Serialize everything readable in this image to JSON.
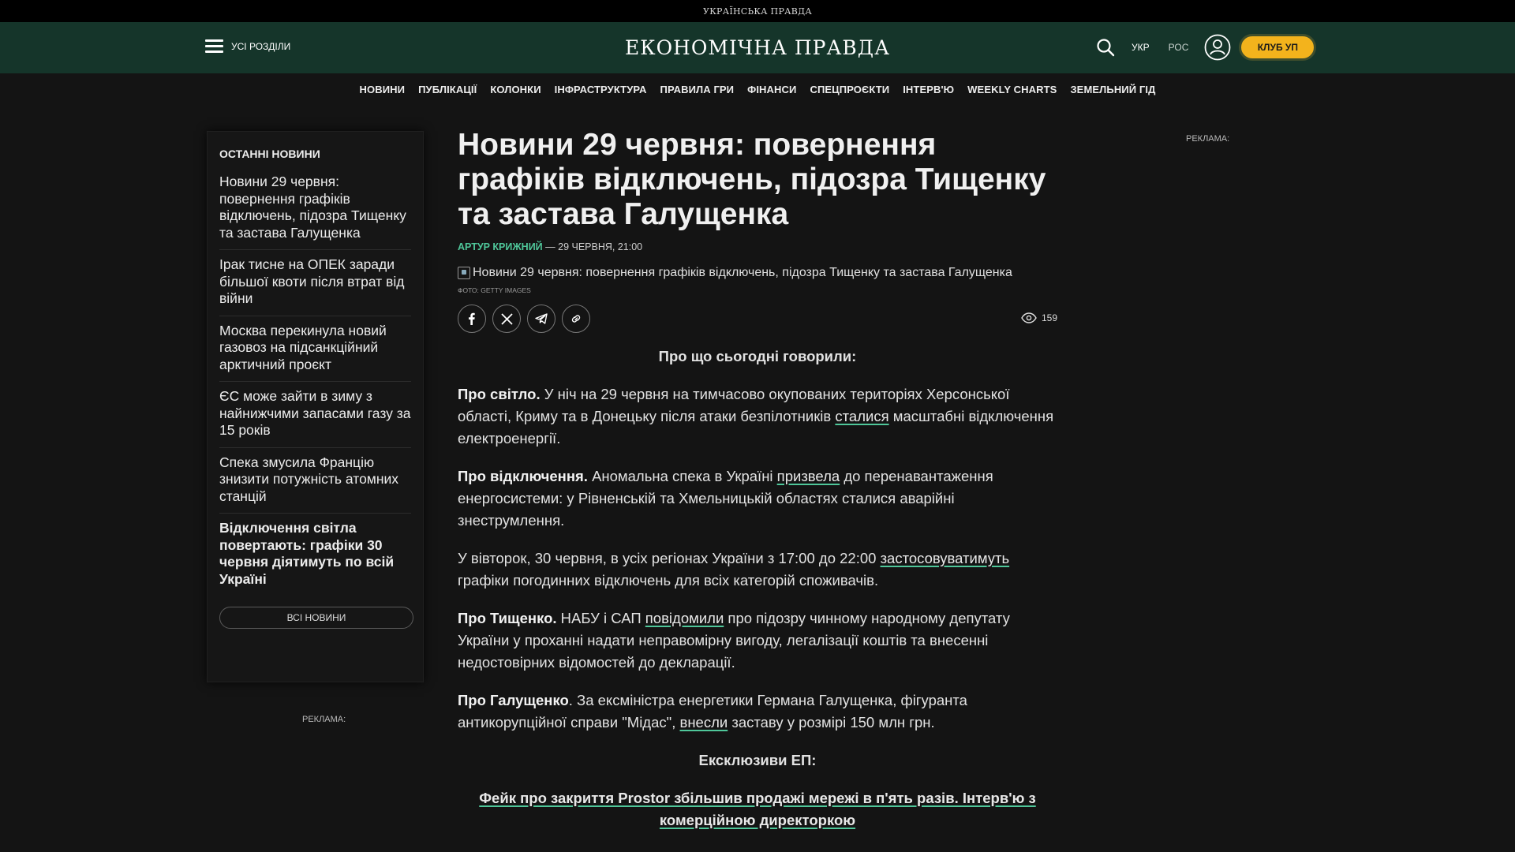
{
  "topstrip": {
    "label": "УКРАЇНСЬКА ПРАВДА"
  },
  "header": {
    "menu_label": "УСІ РОЗДІЛИ",
    "logo": "ЕКОНОМІЧНА ПРАВДА",
    "lang_ukr": "УКР",
    "lang_rus": "РОС",
    "club_label": "КЛУБ УП",
    "accent_color": "#15352a",
    "club_color": "#f3b31c"
  },
  "nav": [
    "НОВИНИ",
    "ПУБЛІКАЦІЇ",
    "КОЛОНКИ",
    "ІНФРАСТРУКТУРА",
    "ПРАВИЛА ГРИ",
    "ФІНАНСИ",
    "СПЕЦПРОЄКТИ",
    "ІНТЕРВ'Ю",
    "WEEKLY CHARTS",
    "ЗЕМЕЛЬНИЙ ГІД"
  ],
  "sidebar": {
    "title": "ОСТАННІ НОВИНИ",
    "items": [
      "Новини 29 червня: повернення графіків відключень, підозра Тищенку та застава Галущенка",
      "Ірак тисне на ОПЕК заради більшої квоти після втрат від війни",
      "Москва перекинула новий газовоз на підсанкційний арктичний проєкт",
      "ЄС може зайти в зиму з найнижчими запасами газу за 15 років",
      "Спека змусила Францію знизити потужність атомних станцій",
      "Відключення світла повертають: графіки 30 червня діятимуть по всій Україні"
    ],
    "all_news": "ВСІ НОВИНИ",
    "ad_label": "РЕКЛАМА:"
  },
  "right_ad_label": "РЕКЛАМА:",
  "article": {
    "title": "Новини 29 червня: повернення графіків відключень, підозра Тищенку та застава Галущенка",
    "author": "АРТУР КРИЖНИЙ",
    "date": " — 29 ЧЕРВНЯ, 21:00",
    "image_alt": "Новини 29 червня: повернення графіків відключень, підозра Тищенку та застава Галущенка",
    "photo_credit": "ФОТО: GETTY IMAGES",
    "views": "159",
    "intro": "Про що сьогодні говорили:",
    "p1_lead": "Про світло.",
    "p1_a": " У ніч на 29 червня на тимчасово окупованих територіях Херсонської області, Криму та в Донецьку після атаки безпілотників ",
    "p1_link": "сталися",
    "p1_b": " масштабні відключення електроенергії.",
    "p2_lead": "Про відключення.",
    "p2_a": " Аномальна спека в Україні ",
    "p2_link": "призвела",
    "p2_b": " до перенавантаження енергосистеми: у Рівненській та Хмельницькій областях сталися аварійні знеструмлення.",
    "p3_a": "У вівторок, 30 червня, в усіх регіонах України з 17:00 до 22:00 ",
    "p3_link": "застосовуватимуть",
    "p3_b": " графіки погодинних відключень для всіх категорій споживачів.",
    "p4_lead": "Про Тищенко.",
    "p4_a": " НАБУ і САП ",
    "p4_link": "повідомили",
    "p4_b": " про підозру чинному народному депутату України у проханні надати неправомірну вигоду, легалізації коштів та внесенні недостовірних відомостей до декларації.",
    "p5_lead": "Про Галущенко",
    "p5_a": ". За ексміністра енергетики Германа Галущенка, фігуранта антикорупційної справи \"Мідас\", ",
    "p5_link": "внесли",
    "p5_b": " заставу у розмірі 150 млн грн.",
    "exclusive": "Ексклюзиви ЕП:",
    "exclusive_link": "Фейк про закриття Prostor збільшив продажі мережі в п'ять разів. Інтерв'ю з комерційною директоркою",
    "link_color": "#4fc79a"
  }
}
